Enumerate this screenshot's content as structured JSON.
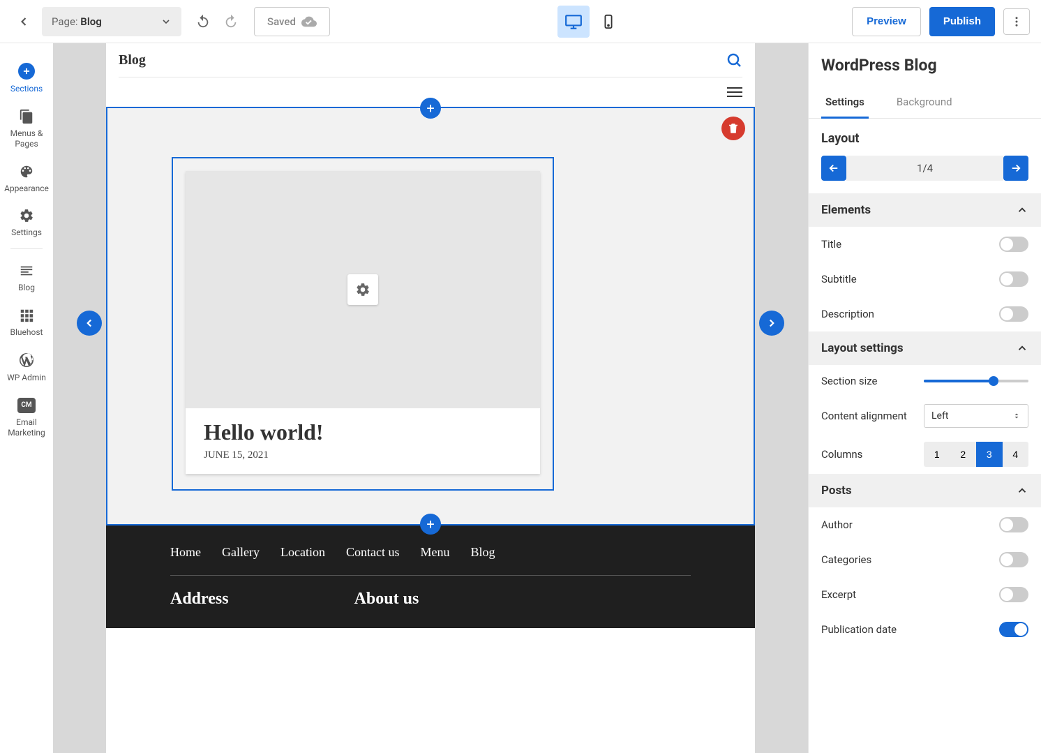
{
  "topbar": {
    "page_prefix": "Page:",
    "page_name": "Blog",
    "saved_label": "Saved",
    "preview_label": "Preview",
    "publish_label": "Publish"
  },
  "sidebar": {
    "items": [
      {
        "label": "Sections"
      },
      {
        "label": "Menus & Pages"
      },
      {
        "label": "Appearance"
      },
      {
        "label": "Settings"
      },
      {
        "label": "Blog"
      },
      {
        "label": "Bluehost"
      },
      {
        "label": "WP Admin"
      },
      {
        "label": "Email Marketing"
      }
    ]
  },
  "canvas": {
    "header_title": "Blog",
    "post_title": "Hello world!",
    "post_date": "JUNE 15, 2021",
    "footer_nav": [
      "Home",
      "Gallery",
      "Location",
      "Contact us",
      "Menu",
      "Blog"
    ],
    "footer_cols": [
      "Address",
      "About us"
    ]
  },
  "panel": {
    "title": "WordPress Blog",
    "tabs": [
      "Settings",
      "Background"
    ],
    "layout_label": "Layout",
    "layout_counter": "1/4",
    "elements_label": "Elements",
    "elements_items": [
      {
        "label": "Title",
        "on": false
      },
      {
        "label": "Subtitle",
        "on": false
      },
      {
        "label": "Description",
        "on": false
      }
    ],
    "layout_settings_label": "Layout settings",
    "section_size_label": "Section size",
    "content_alignment_label": "Content alignment",
    "content_alignment_value": "Left",
    "columns_label": "Columns",
    "columns_options": [
      "1",
      "2",
      "3",
      "4"
    ],
    "columns_selected": "3",
    "posts_label": "Posts",
    "posts_items": [
      {
        "label": "Author",
        "on": false
      },
      {
        "label": "Categories",
        "on": false
      },
      {
        "label": "Excerpt",
        "on": false
      },
      {
        "label": "Publication date",
        "on": true
      }
    ]
  }
}
